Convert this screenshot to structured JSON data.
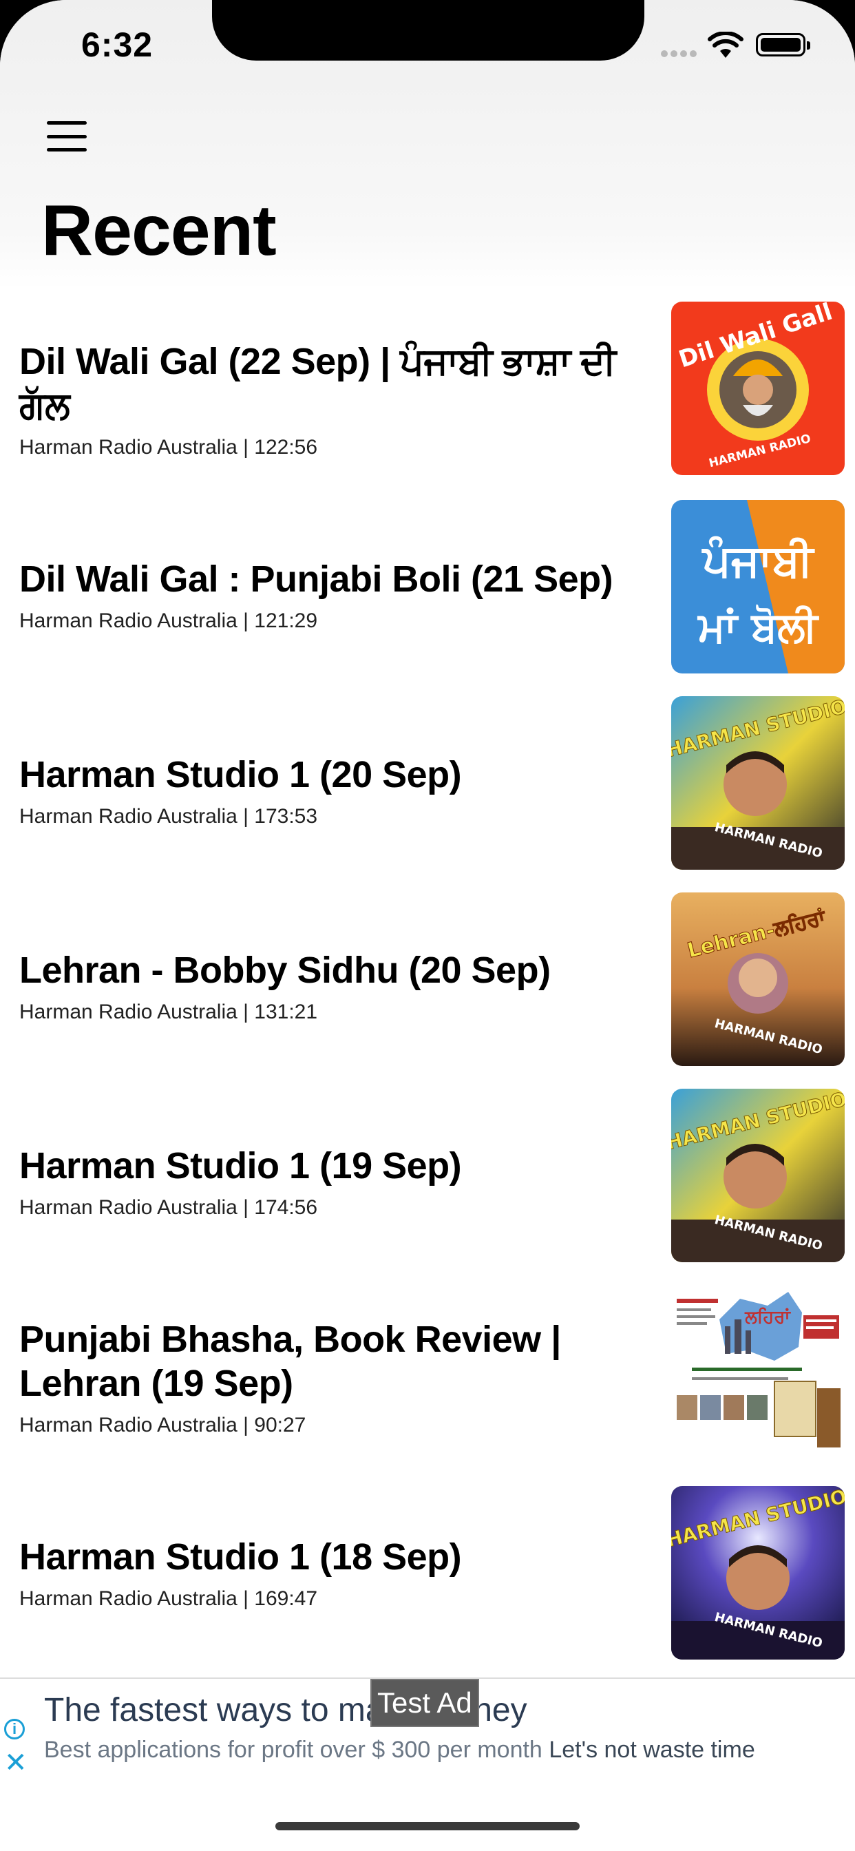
{
  "status_bar": {
    "time": "6:32"
  },
  "header": {
    "title": "Recent",
    "menu_icon": "hamburger-menu-icon"
  },
  "episodes": [
    {
      "title": "Dil Wali Gal (22 Sep) | ਪੰਜਾਬੀ ਭਾਸ਼ਾ ਦੀ ਗੱਲ",
      "meta": "Harman Radio Australia | 122:56"
    },
    {
      "title": "Dil Wali Gal : Punjabi Boli (21 Sep)",
      "meta": "Harman Radio Australia | 121:29"
    },
    {
      "title": "Harman Studio 1 (20 Sep)",
      "meta": "Harman Radio Australia | 173:53"
    },
    {
      "title": "Lehran - Bobby Sidhu (20 Sep)",
      "meta": "Harman Radio Australia | 131:21"
    },
    {
      "title": "Harman Studio 1 (19 Sep)",
      "meta": "Harman Radio Australia | 174:56"
    },
    {
      "title": "Punjabi Bhasha, Book Review | Lehran (19 Sep)",
      "meta": "Harman Radio Australia | 90:27"
    },
    {
      "title": "Harman Studio 1 (18 Sep)",
      "meta": "Harman Radio Australia | 169:47"
    }
  ],
  "thumb_text": {
    "t1_top": "Dil Wali Gall",
    "t1_bottom": "HARMAN RADIO",
    "t2_line1": "ਪੰਜਾਬੀ",
    "t2_line2": "ਮਾਂ ਬੋਲੀ",
    "studio_top": "HARMAN STUDIO",
    "studio_bottom": "HARMAN RADIO",
    "lehran_top": "Lehran-ਲਹਿਰਾਂ",
    "lehran_bottom": "HARMAN RADIO",
    "t6_title": "ਲਹਿਰਾਂ"
  },
  "ad": {
    "badge": "Test Ad",
    "headline": "The fastest ways to make money",
    "description": "Best applications for profit over $ 300 per month",
    "cta": "Let's not waste time"
  },
  "colors": {
    "ad_accent": "#1a9fd6",
    "thumb1_bg": "#f23a1c",
    "thumb2_bg": "#3b8ed8"
  }
}
